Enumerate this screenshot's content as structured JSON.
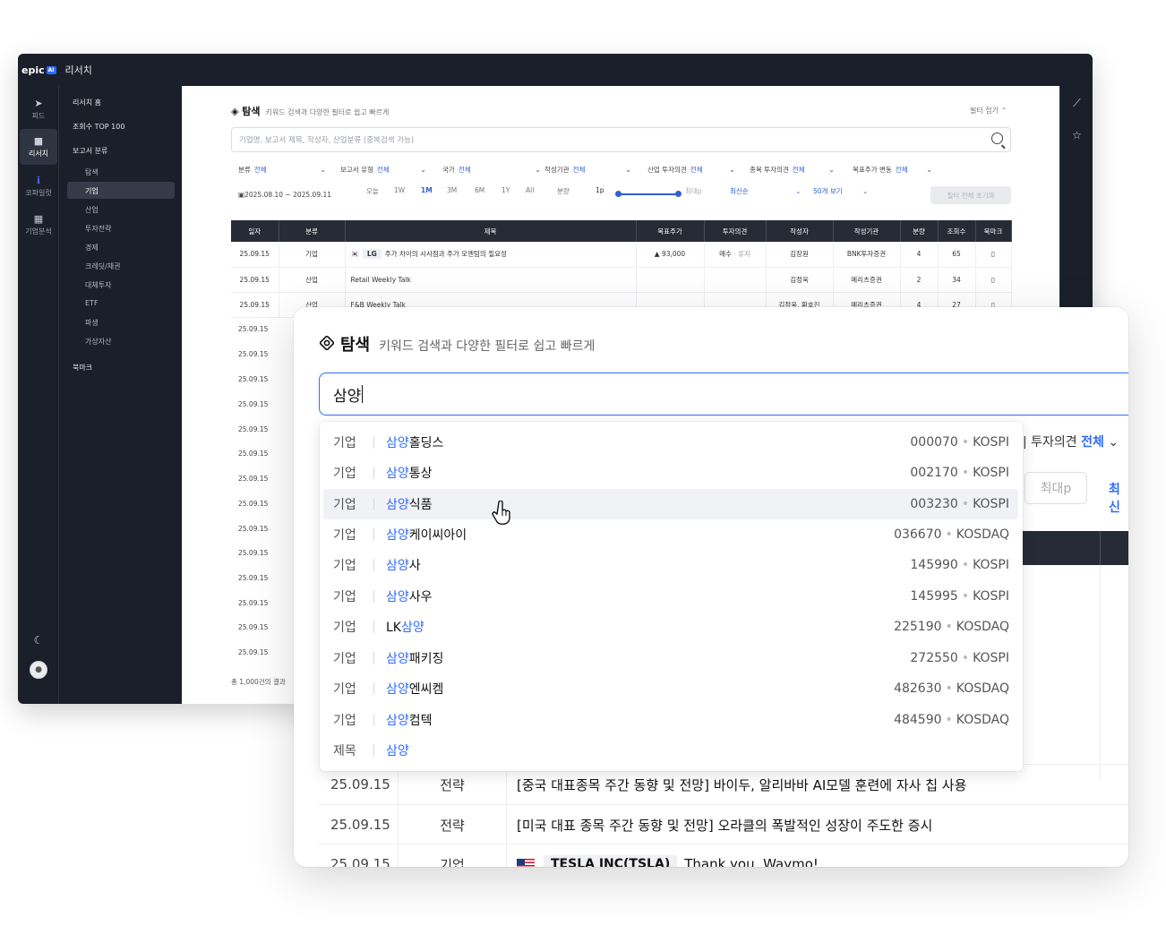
{
  "app": {
    "logo": "epic",
    "logo_badge": "AI",
    "title": "리서치"
  },
  "rail": [
    {
      "label": "피드",
      "icon": "send-icon"
    },
    {
      "label": "리서치",
      "icon": "briefcase-icon",
      "active": true
    },
    {
      "label": "코파일럿",
      "icon": "info-icon"
    },
    {
      "label": "기업분석",
      "icon": "building-icon"
    }
  ],
  "nav": {
    "home": "리서치 홈",
    "top100": "조회수 TOP 100",
    "category": "보고서 분류",
    "items": [
      "탐색",
      "기업",
      "산업",
      "투자전략",
      "경제",
      "크레딧/채권",
      "대체투자",
      "ETF",
      "파생",
      "가상자산"
    ],
    "bookmark": "북마크"
  },
  "content": {
    "title": "탐색",
    "subtitle": "키워드 검색과 다양한 필터로 쉽고 빠르게",
    "fold_label": "필터 접기",
    "search_placeholder": "기업명, 보고서 제목, 작성자, 산업분류 (중복검색 가능)",
    "filters": [
      {
        "label": "분류",
        "value": "전체"
      },
      {
        "label": "보고서 유형",
        "value": "전체"
      },
      {
        "label": "국가",
        "value": "전체"
      },
      {
        "label": "작성기관",
        "value": "전체"
      },
      {
        "label": "산업 투자의견",
        "value": "전체"
      },
      {
        "label": "종목 투자의견",
        "value": "전체"
      },
      {
        "label": "목표주가 변동",
        "value": "전체"
      }
    ],
    "date_range": "2025.08.10 ~ 2025.09.11",
    "periods": [
      "오늘",
      "1W",
      "1M",
      "3M",
      "6M",
      "1Y",
      "All"
    ],
    "period_active": "1M",
    "page_label": "분량",
    "page_min": "1p",
    "page_max": "최대p",
    "sort": "최신순",
    "page_size": "50개 보기",
    "reset": "필터 전체 초기화",
    "columns": [
      "일자",
      "분류",
      "제목",
      "목표주가",
      "투자의견",
      "작성자",
      "작성기관",
      "분량",
      "조회수",
      "북마크"
    ],
    "rows": [
      {
        "date": "25.09.15",
        "cat": "기업",
        "ticker": "LG",
        "title": "주가 차이의 시사점과 주가 모멘텀의 필요성",
        "target": "93,000",
        "opinion": "매수",
        "opinion2": "유지",
        "author": "김장원",
        "org": "BNK투자증권",
        "pages": "4",
        "views": "65"
      },
      {
        "date": "25.09.15",
        "cat": "산업",
        "ticker": "",
        "title": "Retail Weekly Talk",
        "target": "",
        "opinion": "",
        "opinion2": "",
        "author": "김정욱",
        "org": "메리츠증권",
        "pages": "2",
        "views": "34"
      },
      {
        "date": "25.09.15",
        "cat": "산업",
        "ticker": "",
        "title": "F&B Weekly Talk",
        "target": "",
        "opinion": "",
        "opinion2": "",
        "author": "김정욱, 황호진",
        "org": "메리츠증권",
        "pages": "4",
        "views": "27"
      }
    ],
    "dates": [
      "25.09.15",
      "25.09.15",
      "25.09.15",
      "25.09.15",
      "25.09.15",
      "25.09.15",
      "25.09.15",
      "25.09.15",
      "25.09.15",
      "25.09.15",
      "25.09.15",
      "25.09.15",
      "25.09.15",
      "25.09.15",
      "25.09.15",
      "25.09.15"
    ],
    "total": "총 1,000건의 결과"
  },
  "front": {
    "title": "탐색",
    "subtitle": "키워드 검색과 다양한 필터로 쉽고 빠르게",
    "query": "삼양",
    "suggestions": [
      {
        "cat": "기업",
        "pre": "",
        "hl": "삼양",
        "post": "홀딩스",
        "code": "000070",
        "market": "KOSPI"
      },
      {
        "cat": "기업",
        "pre": "",
        "hl": "삼양",
        "post": "통상",
        "code": "002170",
        "market": "KOSPI"
      },
      {
        "cat": "기업",
        "pre": "",
        "hl": "삼양",
        "post": "식품",
        "code": "003230",
        "market": "KOSPI"
      },
      {
        "cat": "기업",
        "pre": "",
        "hl": "삼양",
        "post": "케이씨아이",
        "code": "036670",
        "market": "KOSDAQ"
      },
      {
        "cat": "기업",
        "pre": "",
        "hl": "삼양",
        "post": "사",
        "code": "145990",
        "market": "KOSPI"
      },
      {
        "cat": "기업",
        "pre": "",
        "hl": "삼양",
        "post": "사우",
        "code": "145995",
        "market": "KOSPI"
      },
      {
        "cat": "기업",
        "pre": "LK",
        "hl": "삼양",
        "post": "",
        "code": "225190",
        "market": "KOSDAQ"
      },
      {
        "cat": "기업",
        "pre": "",
        "hl": "삼양",
        "post": "패키징",
        "code": "272550",
        "market": "KOSPI"
      },
      {
        "cat": "기업",
        "pre": "",
        "hl": "삼양",
        "post": "엔씨켐",
        "code": "482630",
        "market": "KOSDAQ"
      },
      {
        "cat": "기업",
        "pre": "",
        "hl": "삼양",
        "post": "컴텍",
        "code": "484590",
        "market": "KOSDAQ"
      },
      {
        "cat": "제목",
        "pre": "",
        "hl": "삼양",
        "post": "",
        "code": "",
        "market": ""
      }
    ],
    "bg_filter_label": "투자의견",
    "bg_filter_value": "전체",
    "bg_chip": "최대p",
    "bg_chip2": "최신",
    "rows": [
      {
        "date": "25.09.15",
        "cat": "전략",
        "title": "[중국 대표종목 주간 동향 및 전망] 바이두, 알리바바 AI모델 훈련에 자사 칩 사용"
      },
      {
        "date": "25.09.15",
        "cat": "전략",
        "title": "[미국 대표 종목 주간 동향 및 전망] 오라클의 폭발적인 성장이 주도한 증시"
      },
      {
        "date": "25.09.15",
        "cat": "기업",
        "ticker": "TESLA INC(TSLA)",
        "title": "Thank you, Waymo!"
      }
    ]
  }
}
